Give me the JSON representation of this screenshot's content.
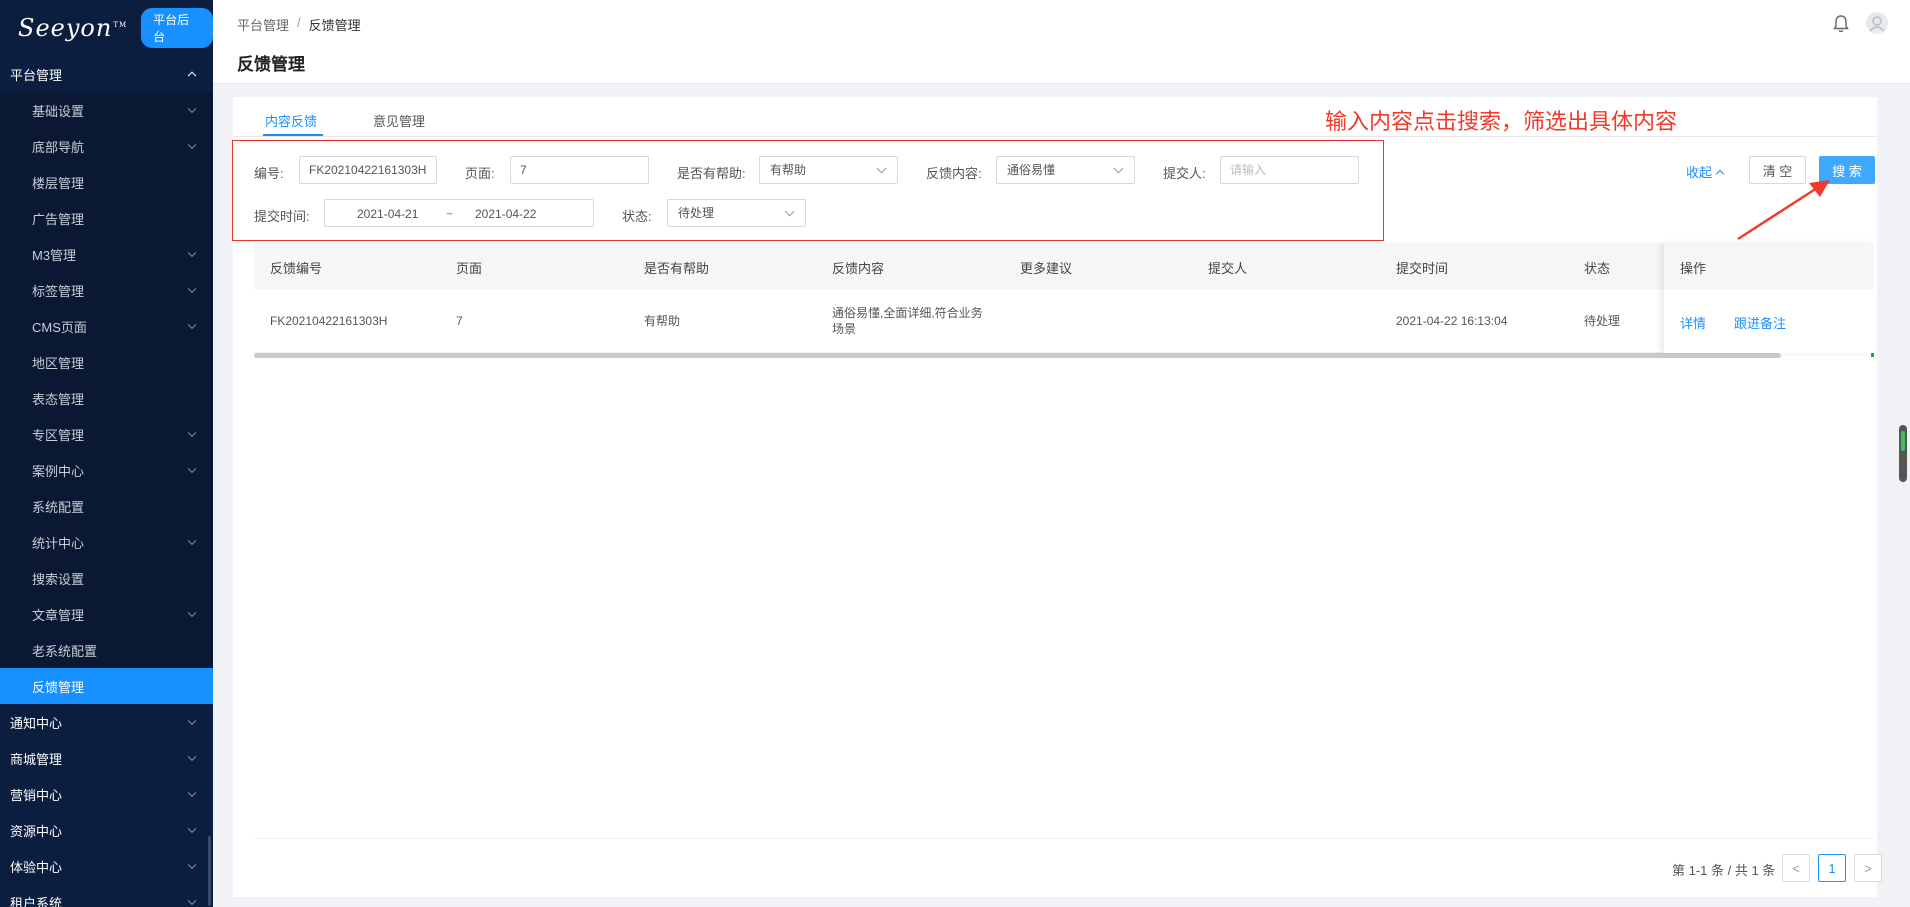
{
  "sidebar": {
    "logo_text": "Seeyon",
    "logo_tm": "TM",
    "badge": "平台后台",
    "group_title": "平台管理",
    "items": [
      {
        "label": "基础设置"
      },
      {
        "label": "底部导航"
      },
      {
        "label": "楼层管理"
      },
      {
        "label": "广告管理"
      },
      {
        "label": "M3管理"
      },
      {
        "label": "标签管理"
      },
      {
        "label": "CMS页面"
      },
      {
        "label": "地区管理"
      },
      {
        "label": "表态管理"
      },
      {
        "label": "专区管理"
      },
      {
        "label": "案例中心"
      },
      {
        "label": "系统配置"
      },
      {
        "label": "统计中心"
      },
      {
        "label": "搜索设置"
      },
      {
        "label": "文章管理"
      },
      {
        "label": "老系统配置"
      },
      {
        "label": "反馈管理"
      }
    ],
    "groups_after": [
      {
        "label": "通知中心"
      },
      {
        "label": "商城管理"
      },
      {
        "label": "营销中心"
      },
      {
        "label": "资源中心"
      },
      {
        "label": "体验中心"
      },
      {
        "label": "租户系统"
      }
    ]
  },
  "header": {
    "breadcrumb": [
      "平台管理",
      "反馈管理"
    ],
    "breadcrumb_sep": "/",
    "title": "反馈管理"
  },
  "tabs": [
    {
      "label": "内容反馈",
      "active": true
    },
    {
      "label": "意见管理",
      "active": false
    }
  ],
  "annotation": "输入内容点击搜索，筛选出具体内容",
  "filters": {
    "code_label": "编号:",
    "code_value": "FK20210422161303H",
    "page_label": "页面:",
    "page_value": "7",
    "helpful_label": "是否有帮助:",
    "helpful_value": "有帮助",
    "content_label": "反馈内容:",
    "content_value": "通俗易懂",
    "submitter_label": "提交人:",
    "submitter_placeholder": "请输入",
    "time_label": "提交时间:",
    "time_start": "2021-04-21",
    "time_sep": "~",
    "time_end": "2021-04-22",
    "status_label": "状态:",
    "status_value": "待处理"
  },
  "actions": {
    "collapse": "收起",
    "clear": "清 空",
    "search": "搜 索"
  },
  "table": {
    "columns": [
      "反馈编号",
      "页面",
      "是否有帮助",
      "反馈内容",
      "更多建议",
      "提交人",
      "提交时间",
      "状态",
      "操作"
    ],
    "rows": [
      {
        "code": "FK20210422161303H",
        "page": "7",
        "helpful": "有帮助",
        "content_line1": "通俗易懂,全面详细,符合业务",
        "content_line2": "场景",
        "suggestion": "",
        "submitter": "",
        "time": "2021-04-22 16:13:04",
        "status": "待处理",
        "op_detail": "详情",
        "op_note": "跟进备注"
      }
    ]
  },
  "pagination": {
    "summary": "第 1-1 条 / 共 1 条",
    "prev": "<",
    "current": "1",
    "next": ">"
  }
}
